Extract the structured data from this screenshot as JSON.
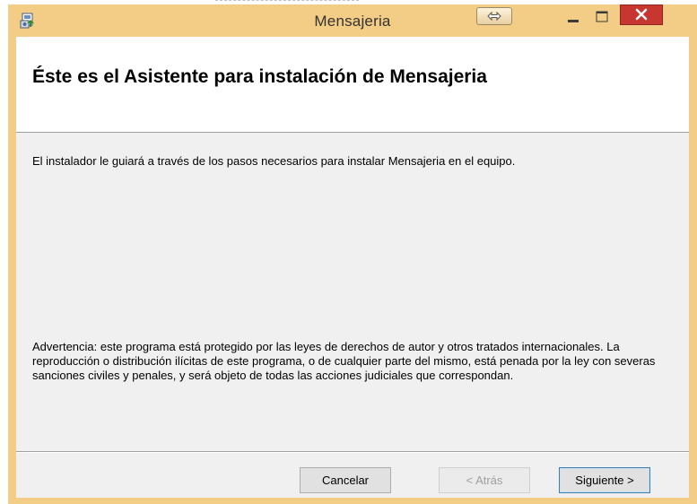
{
  "window": {
    "title": "Mensajeria"
  },
  "header": {
    "title": "Éste es el Asistente para instalación de Mensajeria"
  },
  "body": {
    "intro": "El instalador le guiará a través de los pasos necesarios para instalar Mensajeria en el equipo.",
    "warning": "Advertencia: este programa está protegido por las leyes de derechos de autor y otros tratados internacionales. La reproducción o distribución ilícitas de este programa, o de cualquier parte del mismo, está penada por la ley con severas sanciones civiles y penales, y será objeto de todas las acciones judiciales que correspondan."
  },
  "buttons": {
    "cancel": "Cancelar",
    "back": "< Atrás",
    "next": "Siguiente >"
  },
  "colors": {
    "titlebar": "#f3cd86",
    "close": "#c7372f",
    "client": "#f0f0f0"
  },
  "icons": {
    "app": "installer-icon",
    "extend": "resize-arrows-icon",
    "minimize": "minimize-icon",
    "maximize": "maximize-icon",
    "close": "close-icon"
  }
}
